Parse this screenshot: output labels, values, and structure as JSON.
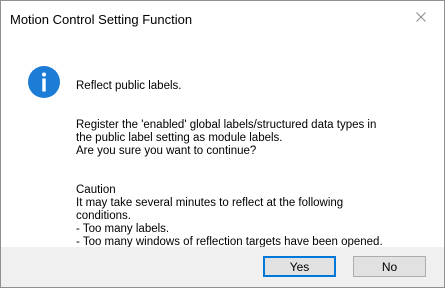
{
  "window": {
    "title": "Motion Control Setting Function",
    "close_icon": "close-icon"
  },
  "message": {
    "icon": "info-icon",
    "icon_color": "#1c7cd6",
    "paragraphs": [
      "Reflect public labels.",
      "Register the 'enabled' global labels/structured data types in\nthe public label setting as module labels.\nAre you sure you want to continue?",
      "Caution\nIt may take several minutes to reflect at the following\nconditions.\n- Too many labels.\n- Too many windows of reflection targets have been opened."
    ]
  },
  "buttons": {
    "yes_label": "Yes",
    "no_label": "No",
    "default_border_color": "#0078d7"
  }
}
